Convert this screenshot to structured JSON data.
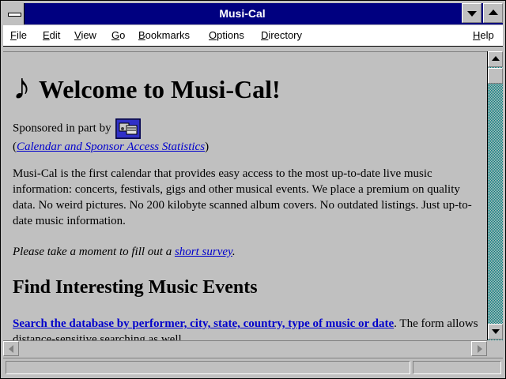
{
  "window": {
    "title": "Musi-Cal"
  },
  "menu": {
    "items": [
      {
        "label": "File",
        "ul": "F",
        "rest": "ile"
      },
      {
        "label": "Edit",
        "ul": "E",
        "rest": "dit"
      },
      {
        "label": "View",
        "ul": "V",
        "rest": "iew"
      },
      {
        "label": "Go",
        "ul": "G",
        "rest": "o"
      },
      {
        "label": "Bookmarks",
        "ul": "B",
        "rest": "ookmarks"
      },
      {
        "label": "Options",
        "ul": "O",
        "rest": "ptions"
      },
      {
        "label": "Directory",
        "ul": "D",
        "rest": "irectory"
      },
      {
        "label": "Help",
        "ul": "H",
        "rest": "elp"
      }
    ]
  },
  "page": {
    "heading": "Welcome to Musi-Cal!",
    "note_glyph": "♪",
    "sponsor_text": "Sponsored in part by",
    "stats_open": "(",
    "stats_link": "Calendar and Sponsor Access Statistics",
    "stats_close": ")",
    "intro": "Musi-Cal is the first calendar that provides easy access to the most up-to-date live music information: concerts, festivals, gigs and other musical events. We place a premium on quality data. No weird pictures. No 200 kilobyte scanned album covers. No outdated listings. Just up-to-date music information.",
    "survey_prefix": "Please take a moment to fill out a ",
    "survey_link": "short survey",
    "survey_suffix": ".",
    "section_heading": "Find Interesting Music Events",
    "search_link": "Search the database by performer, city, state, country, type of music or date",
    "search_suffix": ". The form allows distance-sensitive searching as well."
  },
  "colors": {
    "titlebar": "#000080",
    "desktop": "#008080",
    "link": "#0000cc"
  }
}
